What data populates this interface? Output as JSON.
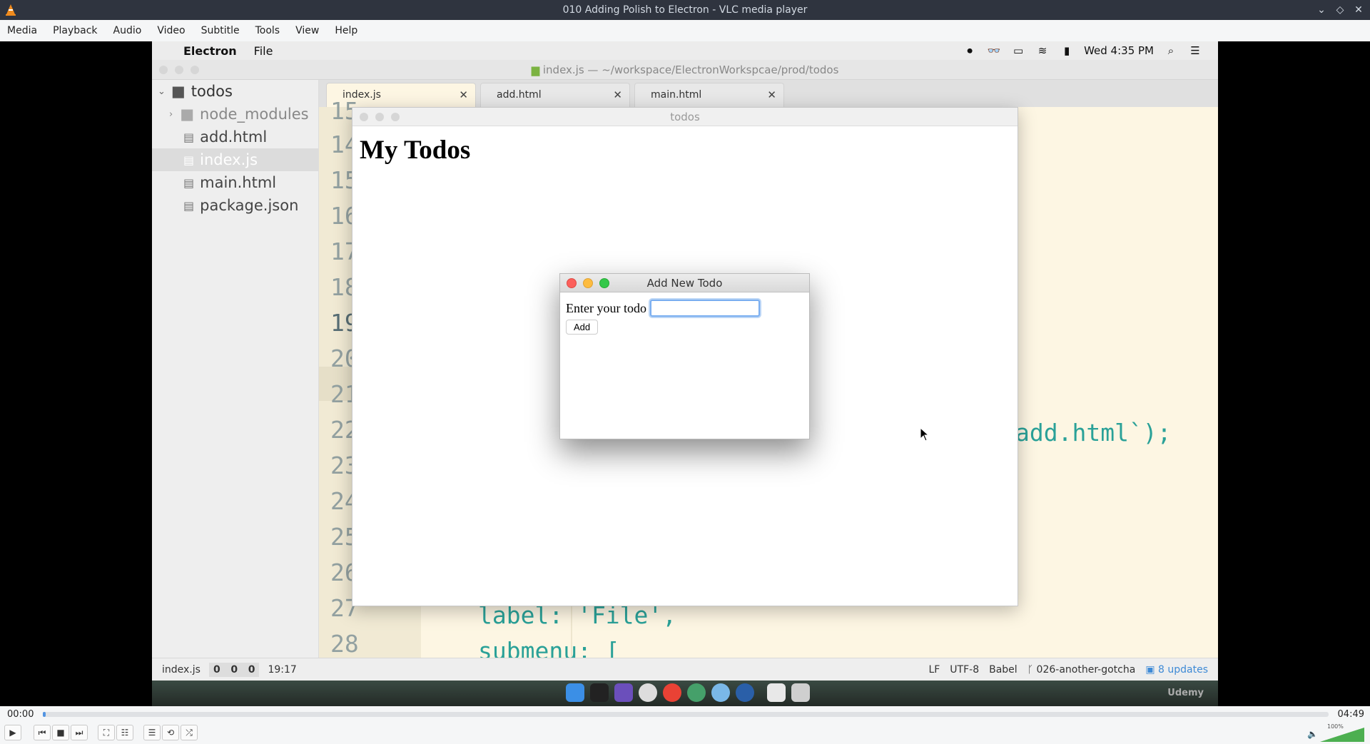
{
  "vlc": {
    "window_title": "010 Adding Polish to Electron - VLC media player",
    "menu": [
      "Media",
      "Playback",
      "Audio",
      "Video",
      "Subtitle",
      "Tools",
      "View",
      "Help"
    ],
    "time_elapsed": "00:00",
    "time_total": "04:49",
    "progress": 0.002,
    "volume_label": "100%"
  },
  "mac": {
    "app_name": "Electron",
    "menu_file": "File",
    "clock": "Wed 4:35 PM"
  },
  "editor": {
    "title": "index.js — ~/workspace/ElectronWorkspcae/prod/todos",
    "tree": {
      "root": "todos",
      "items": [
        "node_modules",
        "add.html",
        "index.js",
        "main.html",
        "package.json"
      ]
    },
    "tabs": [
      "index.js",
      "add.html",
      "main.html"
    ],
    "line_numbers": [
      "15",
      "14",
      "15",
      "16",
      "17",
      "18",
      "19",
      "20",
      "21",
      "22",
      "23",
      "24",
      "25",
      "26",
      "27",
      "28"
    ],
    "code_visible": {
      "line22_tail": "add.html`);",
      "line27": "label: 'File',",
      "line28": "submenu: ["
    },
    "status": {
      "file": "index.js",
      "counts": [
        "0",
        "0",
        "0"
      ],
      "cursor": "19:17",
      "eol": "LF",
      "encoding": "UTF-8",
      "grammar": "Babel",
      "branch": "026-another-gotcha",
      "updates": "8 updates"
    }
  },
  "todos_window": {
    "title": "todos",
    "heading": "My Todos"
  },
  "dialog": {
    "title": "Add New Todo",
    "label": "Enter your todo",
    "input_value": "",
    "button": "Add"
  },
  "watermark": "Udemy"
}
